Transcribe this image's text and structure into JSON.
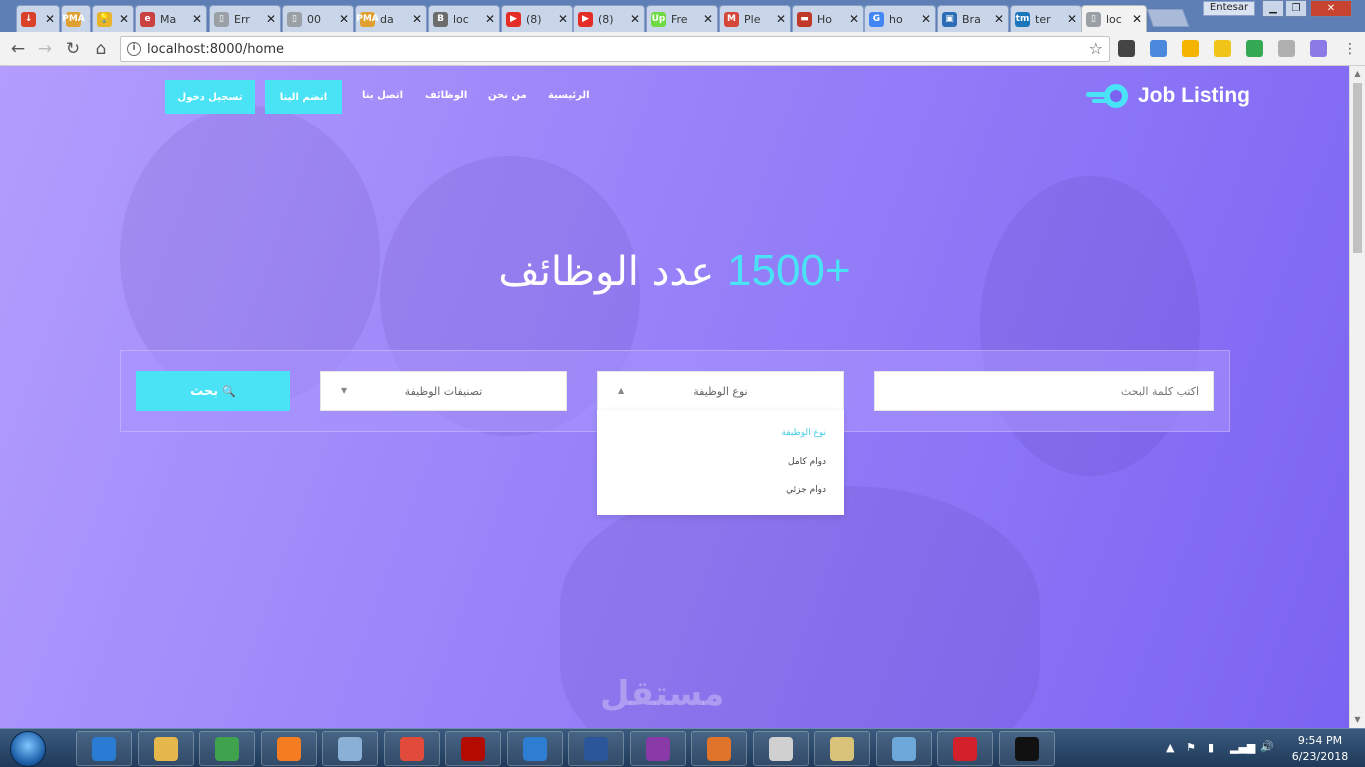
{
  "browser": {
    "tabs": [
      {
        "title": "",
        "fav_color": "#d9412b",
        "fav_glyph": "↓"
      },
      {
        "title": "",
        "fav_color": "#e0a030",
        "fav_glyph": "PMA"
      },
      {
        "title": "",
        "fav_color": "#e8b52a",
        "fav_glyph": "💡"
      },
      {
        "title": "Ma",
        "fav_color": "#c94141",
        "fav_glyph": "e"
      },
      {
        "title": "Err",
        "fav_color": "#9aa0a6",
        "fav_glyph": "▯"
      },
      {
        "title": "00",
        "fav_color": "#9aa0a6",
        "fav_glyph": "▯"
      },
      {
        "title": "da",
        "fav_color": "#e0a030",
        "fav_glyph": "PMA"
      },
      {
        "title": "loc",
        "fav_color": "#6c6c6c",
        "fav_glyph": "B"
      },
      {
        "title": "(8)",
        "fav_color": "#e52d27",
        "fav_glyph": "▶"
      },
      {
        "title": "(8)",
        "fav_color": "#e52d27",
        "fav_glyph": "▶"
      },
      {
        "title": "Fre",
        "fav_color": "#6fda44",
        "fav_glyph": "Up"
      },
      {
        "title": "Ple",
        "fav_color": "#d44638",
        "fav_glyph": "M"
      },
      {
        "title": "Ho",
        "fav_color": "#c0392b",
        "fav_glyph": "▬"
      },
      {
        "title": "ho",
        "fav_color": "#4285f4",
        "fav_glyph": "G"
      },
      {
        "title": "Bra",
        "fav_color": "#2c6db5",
        "fav_glyph": "▣"
      },
      {
        "title": "ter",
        "fav_color": "#1b75bb",
        "fav_glyph": "tm"
      },
      {
        "title": "loc",
        "fav_color": "#9aa0a6",
        "fav_glyph": "▯"
      }
    ],
    "close_glyph": "✕",
    "profile_name": "Entesar",
    "window_min": "▁",
    "window_max": "❐",
    "window_close": "✕",
    "back_glyph": "←",
    "forward_glyph": "→",
    "reload_glyph": "↻",
    "home_glyph": "⌂",
    "info_glyph": "i",
    "url": "localhost:8000/home",
    "star_glyph": "☆"
  },
  "site": {
    "logo_text": "Job Listing",
    "nav": {
      "home": "الرئيسية",
      "about": "من نحن",
      "jobs": "الوظائف",
      "contact": "اتصل بنا"
    },
    "join_label": "انضم الينا",
    "login_label": "تسجيل دخول",
    "hero_number": "+1500",
    "hero_text": "عدد الوظائف",
    "search": {
      "keyword_placeholder": "اكتب كلمة البحث",
      "job_type_label": "نوع الوظيفة",
      "job_type_chevron": "▲",
      "categories_label": "تصنيفات الوظيفة",
      "categories_chevron": "▼",
      "button_label": "بحث",
      "button_icon": "🔍"
    },
    "job_type_options": [
      "نوع الوظيفة",
      "دوام كامل",
      "دوام جزئي"
    ],
    "watermark": "مستقل"
  },
  "taskbar": {
    "apps": [
      {
        "name": "internet-explorer",
        "color": "#2a7bd4"
      },
      {
        "name": "file-explorer",
        "color": "#e6b84c"
      },
      {
        "name": "chrome",
        "color": "#3fa34d"
      },
      {
        "name": "xampp",
        "color": "#f57c20"
      },
      {
        "name": "jc",
        "color": "#8ab0d6"
      },
      {
        "name": "media",
        "color": "#e14b3b"
      },
      {
        "name": "acrobat",
        "color": "#b30b00"
      },
      {
        "name": "brackets",
        "color": "#2d7dd2"
      },
      {
        "name": "word",
        "color": "#2b579a"
      },
      {
        "name": "video",
        "color": "#8a3aa8"
      },
      {
        "name": "tool",
        "color": "#e0742a"
      },
      {
        "name": "paint",
        "color": "#d0d0d0"
      },
      {
        "name": "chart-app",
        "color": "#d9c27a"
      },
      {
        "name": "control-panel",
        "color": "#6ea7d9"
      },
      {
        "name": "opera",
        "color": "#d3202a"
      },
      {
        "name": "cmd",
        "color": "#111111"
      }
    ],
    "time": "9:54 PM",
    "date": "6/23/2018"
  }
}
